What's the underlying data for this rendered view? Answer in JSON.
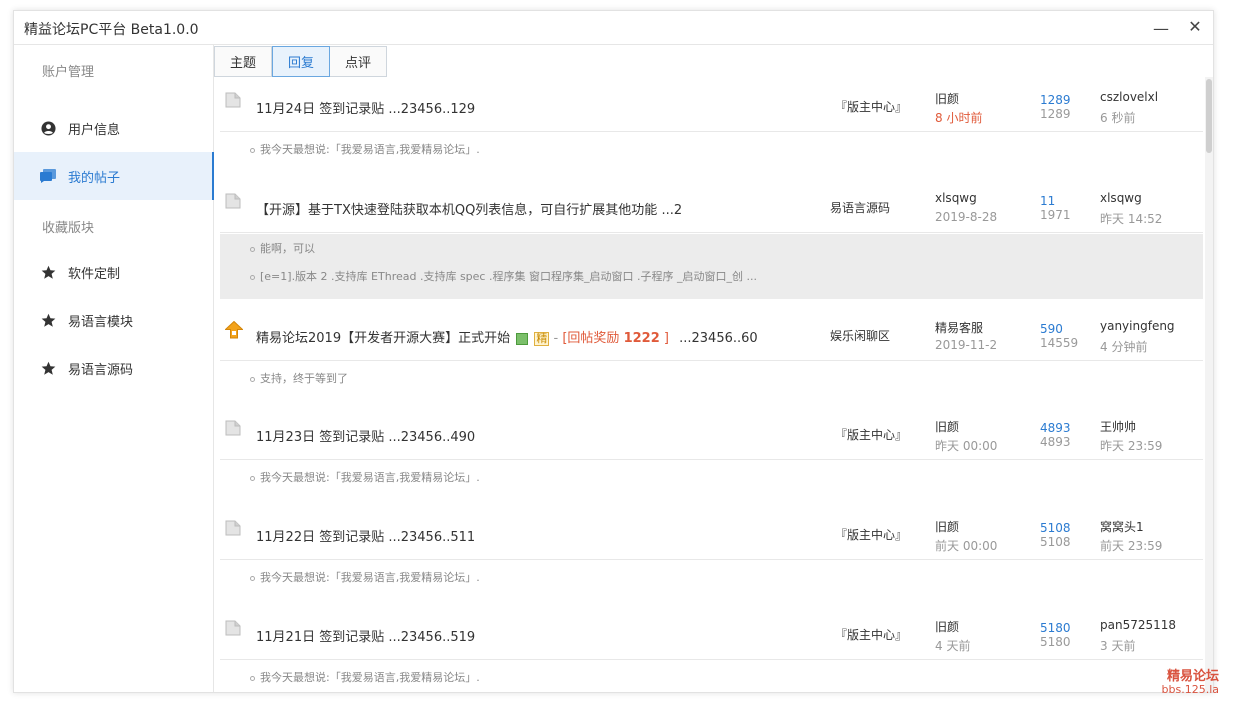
{
  "window": {
    "title": "精益论坛PC平台 Beta1.0.0",
    "minimize": "—",
    "close": "✕"
  },
  "sidebar": {
    "group1": "账户管理",
    "items1": [
      {
        "label": "用户信息",
        "icon": "user-circle-icon"
      },
      {
        "label": "我的帖子",
        "icon": "posts-icon",
        "active": true
      }
    ],
    "group2": "收藏版块",
    "items2": [
      {
        "label": "软件定制",
        "icon": "star-icon"
      },
      {
        "label": "易语言模块",
        "icon": "star-icon"
      },
      {
        "label": "易语言源码",
        "icon": "star-icon"
      }
    ]
  },
  "tabs": [
    {
      "label": "主题"
    },
    {
      "label": "回复",
      "active": true
    },
    {
      "label": "点评"
    }
  ],
  "posts": [
    {
      "title": "11月24日 签到记录贴 ...23456..129",
      "forum": "『版主中心』",
      "author": "旧颜",
      "date": "8 小时前",
      "date_hot": true,
      "replies": "1289",
      "views": "1289",
      "last_user": "cszlovelxl",
      "last_time": "6 秒前",
      "reply_lines": [
        "我今天最想说:「我爱易语言,我爱精易论坛」."
      ]
    },
    {
      "title": "【开源】基于TX快速登陆获取本机QQ列表信息，可自行扩展其他功能 ...2",
      "forum": "易语言源码",
      "author": "xlsqwg",
      "date": "2019-8-28",
      "replies": "11",
      "views": "1971",
      "last_user": "xlsqwg",
      "last_time": "昨天 14:52",
      "reply_lines": [
        "能啊，可以",
        "[e=1].版本 2 .支持库 EThread .支持库 spec .程序集 窗口程序集_启动窗口 .子程序 _启动窗口_创 ..."
      ]
    },
    {
      "title": "精易论坛2019【开发者开源大赛】正式开始",
      "badge_jing": "精",
      "reward_text": "[回帖奖励 ",
      "reward_num": "1222",
      "reward_end": " ]",
      "pages": "...23456..60",
      "forum": "娱乐闲聊区",
      "author": "精易客服",
      "date": "2019-11-2",
      "replies": "590",
      "views": "14559",
      "last_user": "yanyingfeng",
      "last_time": "4 分钟前",
      "reply_lines": [
        "支持，终于等到了"
      ]
    },
    {
      "title": "11月23日 签到记录贴 ...23456..490",
      "forum": "『版主中心』",
      "author": "旧颜",
      "date": "昨天 00:00",
      "replies": "4893",
      "views": "4893",
      "last_user": "王帅帅",
      "last_time": "昨天 23:59",
      "reply_lines": [
        "我今天最想说:「我爱易语言,我爱精易论坛」."
      ]
    },
    {
      "title": "11月22日 签到记录贴 ...23456..511",
      "forum": "『版主中心』",
      "author": "旧颜",
      "date": "前天 00:00",
      "replies": "5108",
      "views": "5108",
      "last_user": "窝窝头1",
      "last_time": "前天 23:59",
      "reply_lines": [
        "我今天最想说:「我爱易语言,我爱精易论坛」."
      ]
    },
    {
      "title": "11月21日 签到记录贴 ...23456..519",
      "forum": "『版主中心』",
      "author": "旧颜",
      "date": "4 天前",
      "replies": "5180",
      "views": "5180",
      "last_user": "pan5725118",
      "last_time": "3 天前",
      "reply_lines": [
        "我今天最想说:「我爱易语言,我爱精易论坛」."
      ]
    }
  ],
  "watermark": {
    "line1": "精易论坛",
    "line2": "bbs.125.la"
  }
}
